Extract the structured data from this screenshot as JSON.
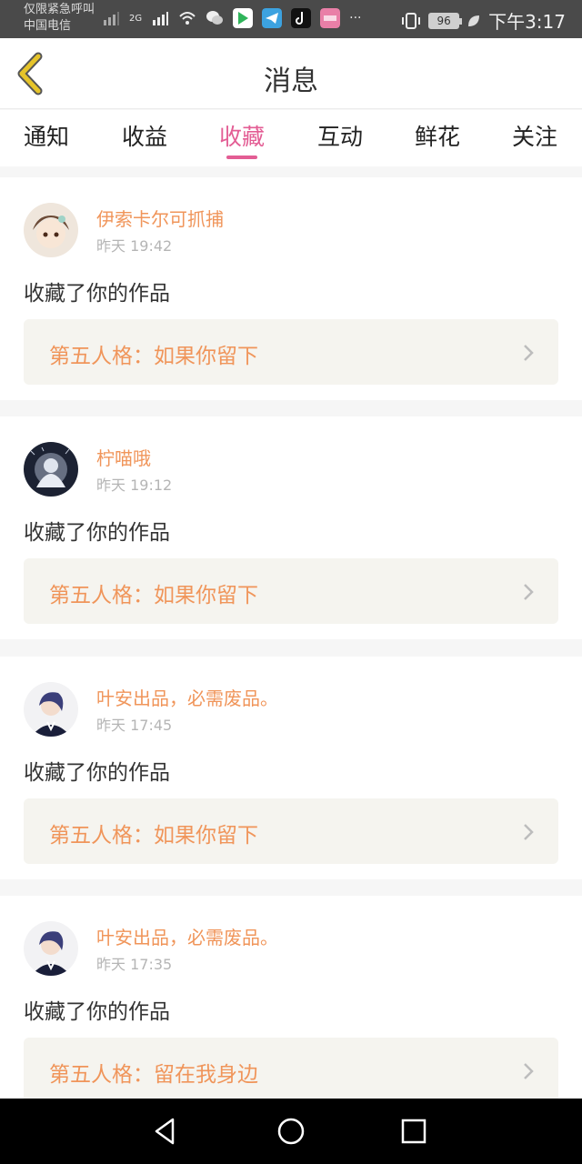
{
  "status_bar": {
    "carrier_line1": "仅限紧急呼叫",
    "carrier_line2": "中国电信",
    "network": "2G",
    "battery": "96",
    "time": "下午3:17"
  },
  "header": {
    "title": "消息",
    "back_icon": "back-chevron-icon"
  },
  "tabs": [
    {
      "label": "通知",
      "active": false
    },
    {
      "label": "收益",
      "active": false
    },
    {
      "label": "收藏",
      "active": true
    },
    {
      "label": "互动",
      "active": false
    },
    {
      "label": "鲜花",
      "active": false
    },
    {
      "label": "关注",
      "active": false
    }
  ],
  "messages": [
    {
      "username": "伊索卡尔可抓捕",
      "time": "昨天 19:42",
      "action": "收藏了你的作品",
      "work_title": "第五人格：如果你留下"
    },
    {
      "username": "柠喵哦",
      "time": "昨天 19:12",
      "action": "收藏了你的作品",
      "work_title": "第五人格：如果你留下"
    },
    {
      "username": "叶安出品，必需废品。",
      "time": "昨天 17:45",
      "action": "收藏了你的作品",
      "work_title": "第五人格：如果你留下"
    },
    {
      "username": "叶安出品，必需废品。",
      "time": "昨天 17:35",
      "action": "收藏了你的作品",
      "work_title": "第五人格：留在我身边"
    }
  ],
  "colors": {
    "accent_pink": "#e35d94",
    "name_orange": "#f0955a",
    "back_icon_yellow": "#e6c42a",
    "link_bg": "#f5f4ef"
  },
  "nav_bar": {
    "back": "triangle-back-icon",
    "home": "circle-home-icon",
    "recents": "square-recents-icon"
  }
}
